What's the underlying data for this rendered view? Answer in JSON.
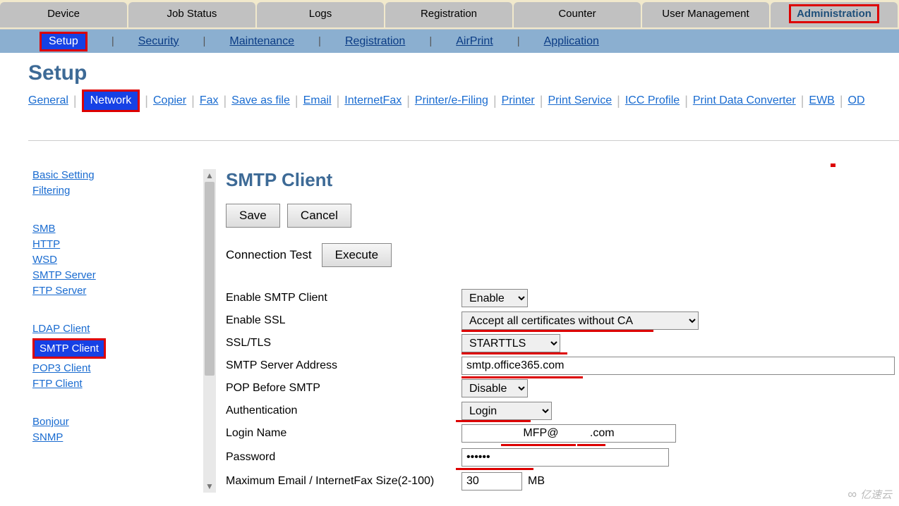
{
  "main_tabs": [
    "Device",
    "Job Status",
    "Logs",
    "Registration",
    "Counter",
    "User Management",
    "Administration"
  ],
  "sub_nav": {
    "items": [
      "Setup",
      "Security",
      "Maintenance",
      "Registration",
      "AirPrint",
      "Application"
    ],
    "active": "Setup"
  },
  "page_title": "Setup",
  "setup_tabs": [
    "General",
    "Network",
    "Copier",
    "Fax",
    "Save as file",
    "Email",
    "InternetFax",
    "Printer/e-Filing",
    "Printer",
    "Print Service",
    "ICC Profile",
    "Print Data Converter",
    "EWB",
    "OD"
  ],
  "setup_active": "Network",
  "sidebar_groups": [
    [
      "Basic Setting",
      "Filtering"
    ],
    [
      "SMB",
      "HTTP",
      "WSD",
      "SMTP Server",
      "FTP Server"
    ],
    [
      "LDAP Client",
      "SMTP Client",
      "POP3 Client",
      "FTP Client"
    ],
    [
      "Bonjour",
      "SNMP"
    ]
  ],
  "sidebar_selected": "SMTP Client",
  "content": {
    "title": "SMTP Client",
    "save": "Save",
    "cancel": "Cancel",
    "conn_test_label": "Connection Test",
    "execute": "Execute",
    "rows": {
      "enable_client_lbl": "Enable SMTP Client",
      "enable_client_val": "Enable",
      "enable_ssl_lbl": "Enable SSL",
      "enable_ssl_val": "Accept all certificates without CA",
      "ssltls_lbl": "SSL/TLS",
      "ssltls_val": "STARTTLS",
      "server_lbl": "SMTP Server Address",
      "server_val": "smtp.office365.com",
      "pop_lbl": "POP Before SMTP",
      "pop_val": "Disable",
      "auth_lbl": "Authentication",
      "auth_val": "Login",
      "login_lbl": "Login Name",
      "login_val": "MFP@          .com",
      "pass_lbl": "Password",
      "pass_val": "••••••",
      "max_lbl": "Maximum Email / InternetFax Size(2-100)",
      "max_val": "30",
      "max_unit": "MB"
    }
  },
  "watermark": "亿速云"
}
